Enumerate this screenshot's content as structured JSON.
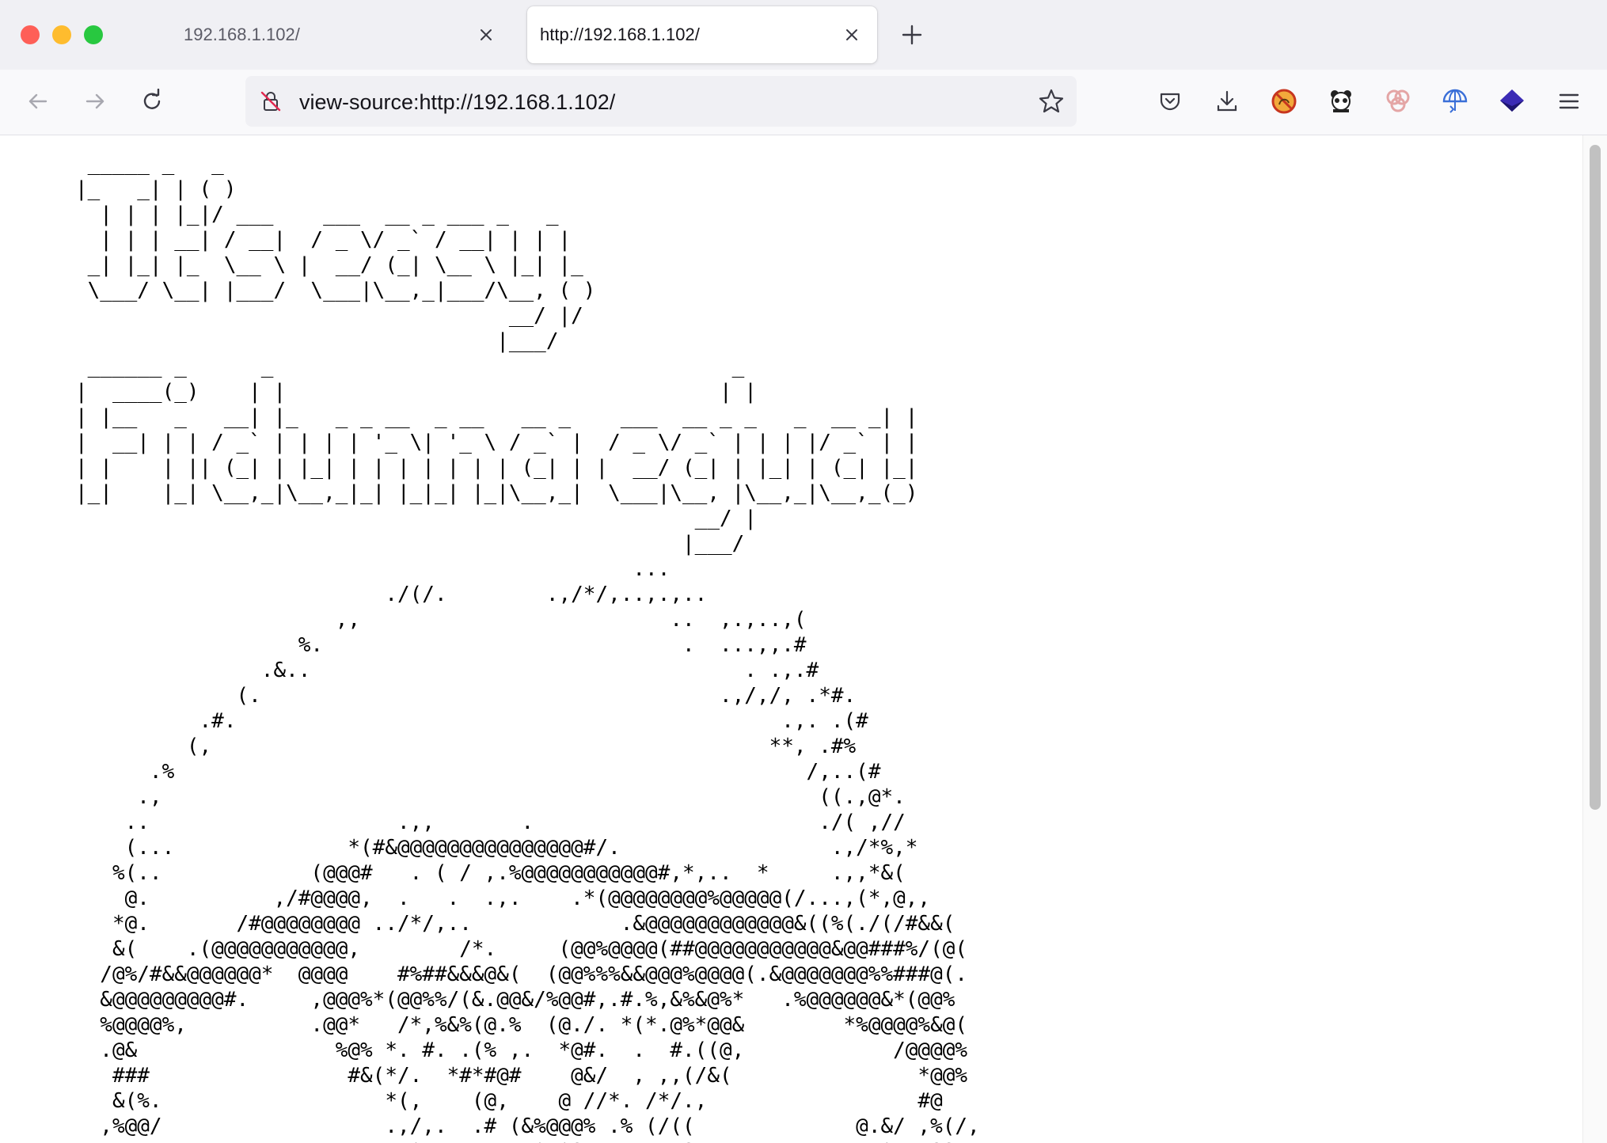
{
  "tabs": [
    {
      "label": "192.168.1.102/",
      "active": false
    },
    {
      "label": "http://192.168.1.102/",
      "active": true
    }
  ],
  "address_bar": {
    "value": "view-source:http://192.168.1.102/"
  },
  "toolbar_icons": [
    "pocket-icon",
    "downloads-icon",
    "extension-blocker-icon",
    "extension-panda-icon",
    "extension-circles-icon",
    "extension-vpn-icon",
    "extension-layers-icon",
    "menu-icon"
  ],
  "colors": {
    "tab_strip": "#f0f0f4",
    "toolbar": "#f9f9fb",
    "active_tab": "#ffffff"
  },
  "page_source": " _____ _   _\n|_   _| | ( )\n  | | | |_|/ ___    ___  __ _ ___ _   _\n  | | | __| / __|  / _ \\/ _` / __| | | |\n _| |_| |_  \\__ \\ |  __/ (_| \\__ \\ |_| |_\n \\___/ \\__| |___/  \\___|\\__,_|___/\\__, ( )\n                                   __/ |/\n                                  |___/\n ______ _      _                                     _\n|  ____(_)    | |                                   | |\n| |__   _   __| |_   _ _ __  _ __   __ _    ___  __ _ _   _  __ _| |\n|  __| | | / _` | | | | '_ \\| '_ \\ / _` |  / _ \\/ _` | | | |/ _` | |\n| |    | || (_| | |_| | | | | | | | (_| | |  __/ (_| | |_| | (_| |_|\n|_|    |_| \\__,_|\\__,_|_| |_|_| |_|\\__,_|  \\___|\\__, |\\__,_|\\__,_(_)\n                                                  __/ |\n                                                 |___/\n                                             ...\n                         ./(/.        .,/*/,..,.,..\n                     ,,                         ..  ,.,..,(\n                  %.                             .  ...,,.#\n               .&..                                   . .,.#\n             (.                                     .,/,/, .*#.\n          .#.                                            .,. .(#\n         (,                                             **, .#%\n      .%                                                   /,..(#\n     .,                                                     ((.,@*.\n    ..                    .,,       .                       ./( ,//\n    (...              *(#&@@@@@@@@@@@@@@@#/.                 .,/*%,*\n   %(..            (@@@#   . ( / ,.%@@@@@@@@@@@#,*,..  *     .,,*&(\n    @.          ,/#@@@@,  .   .  .,.    .*(@@@@@@@@%@@@@@(/...,(*,@,,\n   *@.       /#@@@@@@@@ ../*/,..            .&@@@@@@@@@@@@&((%(./(/#&&(\n   &(    .(@@@@@@@@@@@,        /*.     (@@%@@@@(##@@@@@@@@@@@&@@###%/(@(\n  /@%/#&&@@@@@@*  @@@@    #%##&&&@&(  (@@%%%&&@@@%@@@@(.&@@@@@@@%%###@(.\n  &@@@@@@@@@#.     ,@@@%*(@@%%/(&.@@&/%@@#,.#.%,&%&@%*   .%@@@@@@&*(@@%\n  %@@@@%,          .@@*   /*,%&%(@.%  (@./. *(*.@%*@@&        *%@@@@%&@(\n  .@&                %@% *. #. .(% ,.  *@#.  .  #.((@,            /@@@@%\n   ###                #&(*/.  *#*#@#    @&/  , ,,(/&(               *@@%\n   &(%.                  *(,    (@,    @ //*. /*/.,                 #@\n  ,%@@/                  .,/,.  .# (&%@@@% .% (/((             @.&/ ,%(/,\n  /#                    ./#*,.#.   .,*@*&  ./.#  &%/           #%*@..&&/#/"
}
